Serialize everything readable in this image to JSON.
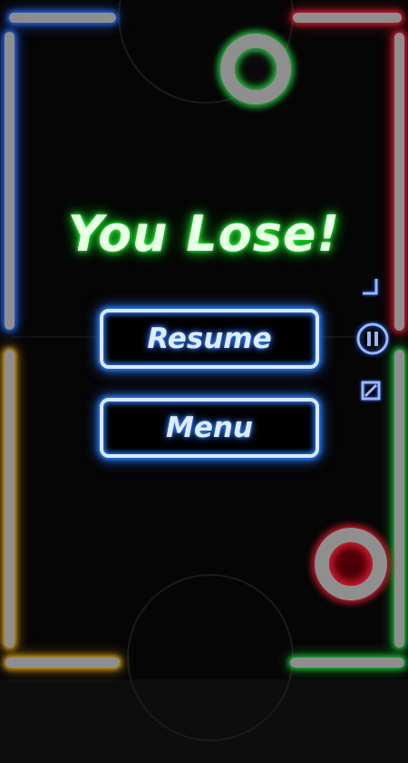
{
  "game": {
    "result_title": "You Lose!",
    "buttons": {
      "resume_label": "Resume",
      "menu_label": "Menu"
    }
  },
  "colors": {
    "player_top": "#2bdc45",
    "player_bottom": "#e6283a",
    "wall_top_left": "#2a6cff",
    "wall_top_right": "#e6283a",
    "wall_bottom_left": "#e0a81e",
    "wall_bottom_right": "#22c840",
    "button_glow": "#2a7dff",
    "title_glow": "#2cff3a"
  },
  "icons": {
    "corner": "corner-bracket-icon",
    "pause": "pause-icon",
    "stop": "stop-square-icon"
  }
}
